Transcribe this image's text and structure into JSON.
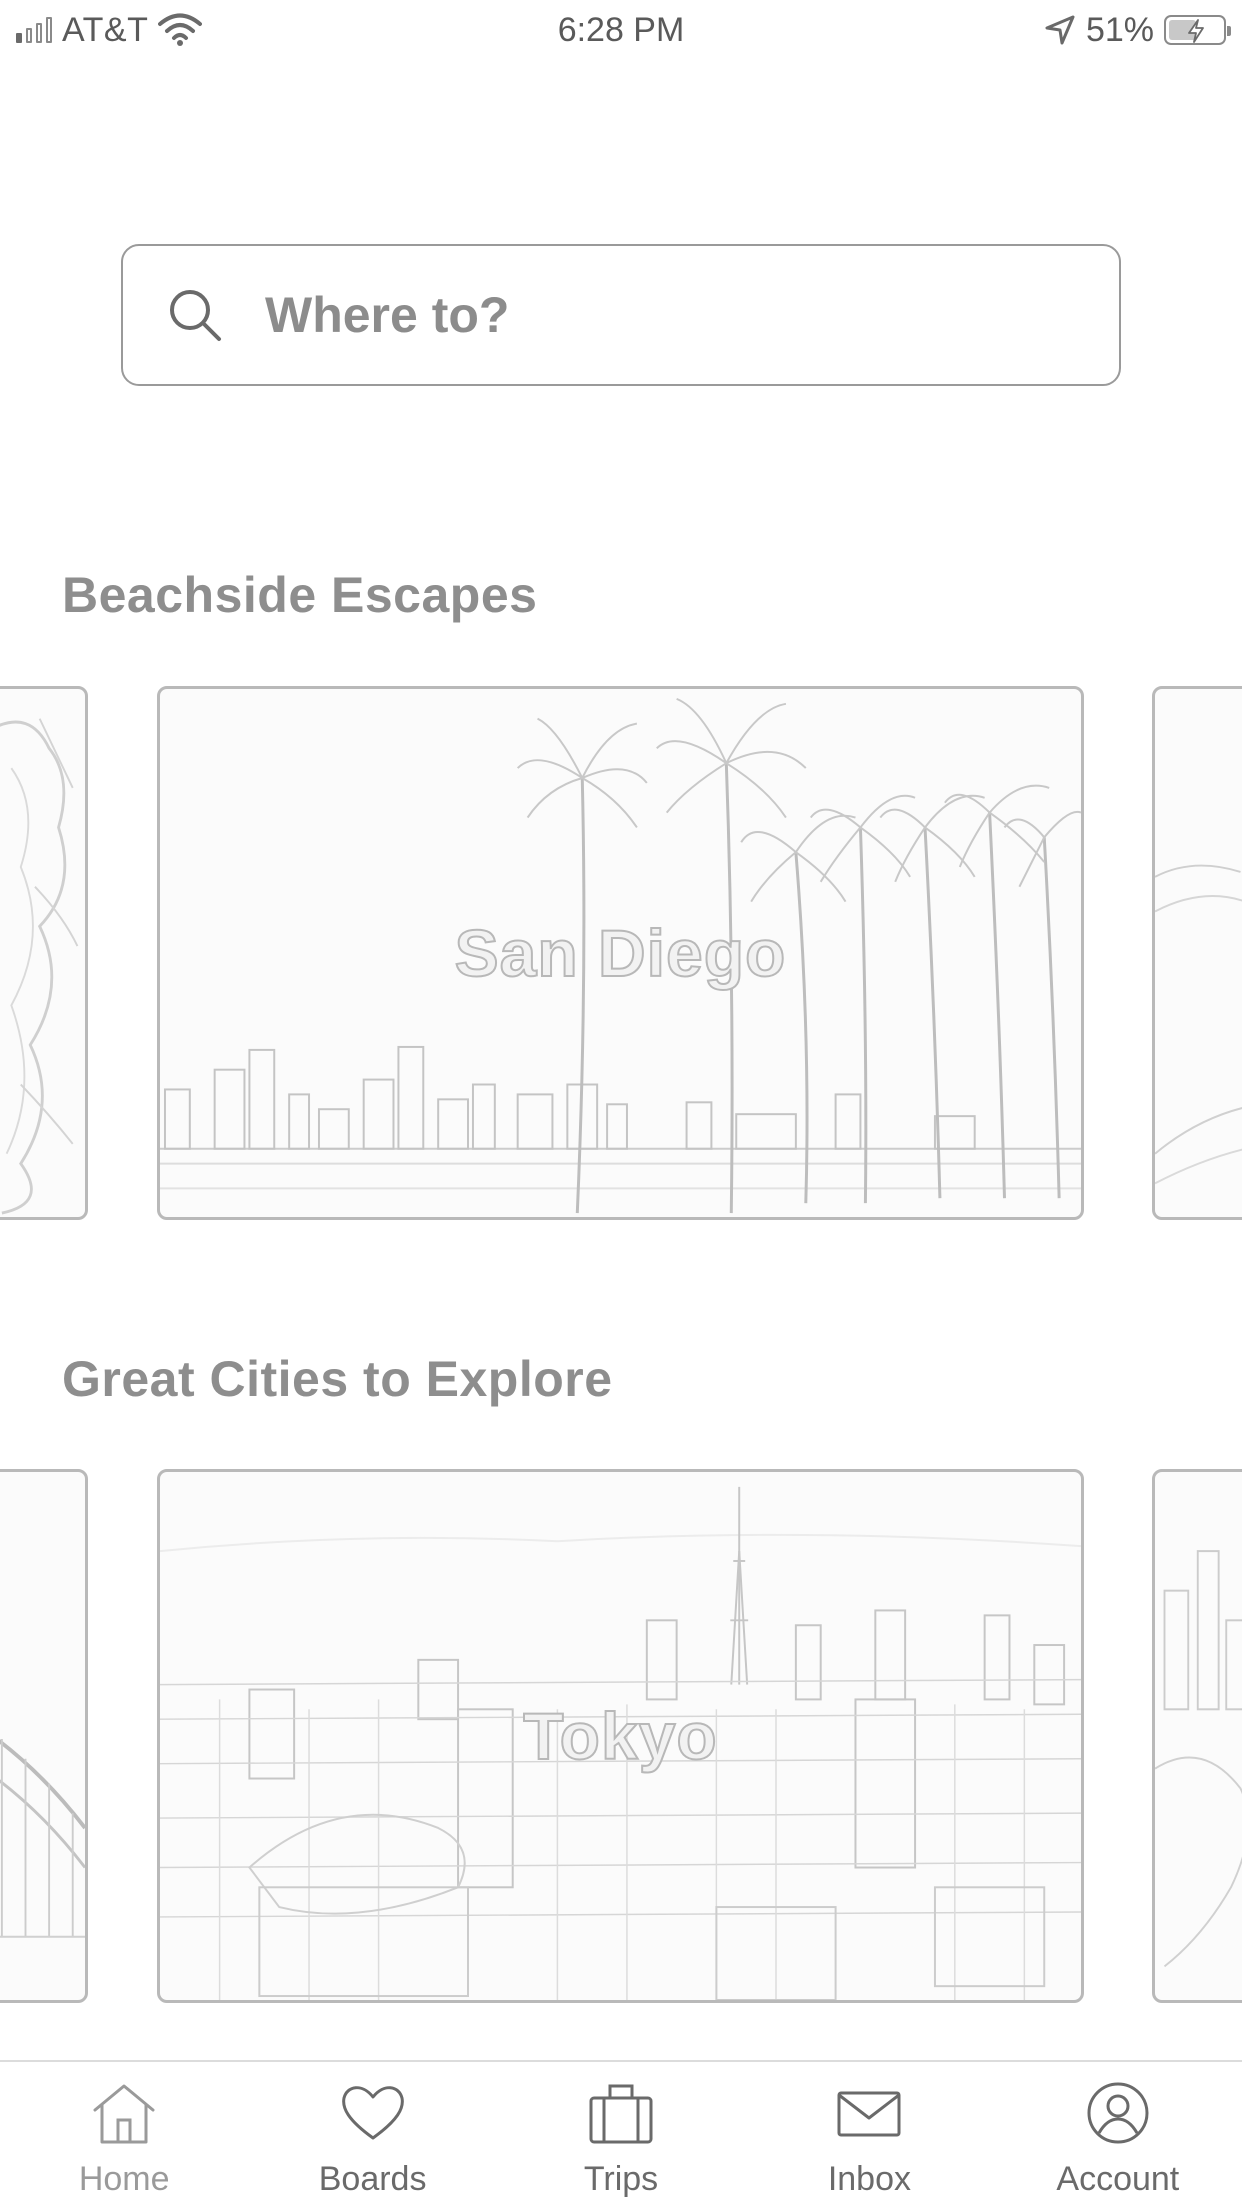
{
  "status_bar": {
    "carrier": "AT&T",
    "time": "6:28 PM",
    "battery_percent": "51%",
    "battery_level": 0.51,
    "signal_bars": 1,
    "icons": [
      "signal-icon",
      "wifi-icon",
      "location-arrow-icon",
      "battery-charging-icon"
    ]
  },
  "search": {
    "placeholder": "Where to?",
    "value": "",
    "icon": "search-icon"
  },
  "sections": [
    {
      "title": "Beachside Escapes",
      "featured_card": {
        "label": "San Diego",
        "image": "palm-trees-skyline-photo"
      }
    },
    {
      "title": "Great Cities to Explore",
      "featured_card": {
        "label": "Tokyo",
        "image": "city-tower-skyline-photo"
      }
    }
  ],
  "tab_bar": {
    "active": "Home",
    "tabs": [
      {
        "label": "Home",
        "icon": "home-icon"
      },
      {
        "label": "Boards",
        "icon": "heart-icon"
      },
      {
        "label": "Trips",
        "icon": "suitcase-icon"
      },
      {
        "label": "Inbox",
        "icon": "envelope-icon"
      },
      {
        "label": "Account",
        "icon": "user-circle-icon"
      }
    ]
  }
}
